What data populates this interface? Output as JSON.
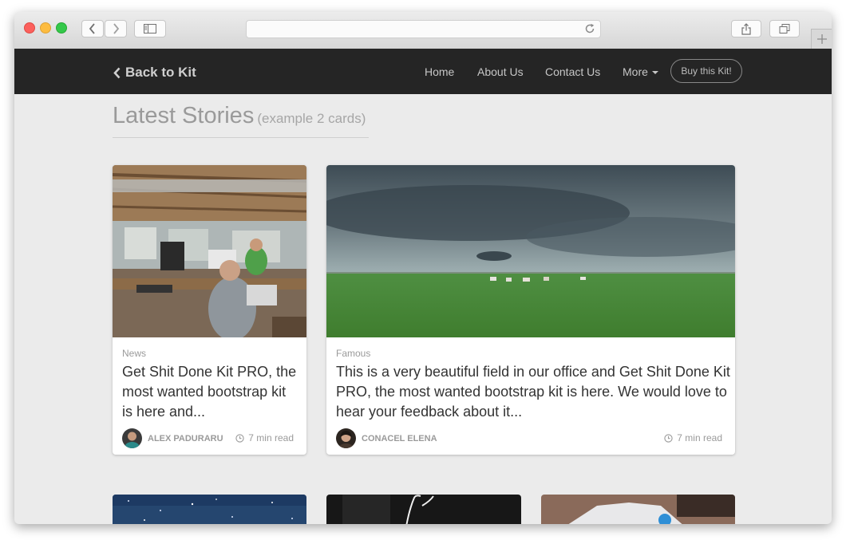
{
  "navbar": {
    "back_label": "Back to Kit",
    "items": [
      "Home",
      "About Us",
      "Contact Us",
      "More"
    ],
    "buy_label": "Buy this Kit!"
  },
  "section": {
    "title": "Latest Stories",
    "subtitle": "(example 2 cards)"
  },
  "cards": [
    {
      "category": "News",
      "title": "Get Shit Done Kit PRO, the most wanted bootstrap kit is here and...",
      "author": "ALEX PADURARU",
      "read_time": "7 min read"
    },
    {
      "category": "Famous",
      "title": "This is a very beautiful field in our office and Get Shit Done Kit PRO, the most wanted bootstrap kit is here. We would love to hear your feedback about it...",
      "author": "CONACEL ELENA",
      "read_time": "7 min read"
    }
  ],
  "colors": {
    "navbar_bg": "#252525",
    "page_bg": "#ebebeb",
    "card_bg": "#ffffff",
    "muted_text": "#9a9a9a"
  },
  "icons": {
    "back": "chevron-left-icon",
    "more": "caret-down-icon",
    "time": "clock-icon"
  }
}
